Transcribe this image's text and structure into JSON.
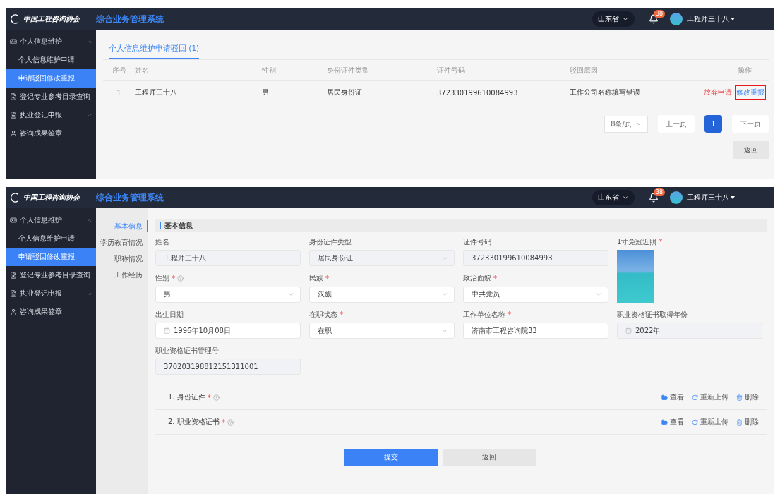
{
  "screens": [
    {
      "kind": "list",
      "header": {
        "logo_text": "中国工程咨询协会",
        "system_title": "综合业务管理系统",
        "region": "山东省",
        "notification_count": "38",
        "user_name": "工程师三十八"
      },
      "sidebar": [
        {
          "label": "个人信息维护",
          "expanded": true,
          "children": [
            {
              "label": "个人信息维护申请",
              "selected": false
            },
            {
              "label": "申请驳回修改重报",
              "selected": true
            }
          ]
        },
        {
          "label": "登记专业参考目录查询"
        },
        {
          "label": "执业登记申报",
          "expanded": false
        },
        {
          "label": "咨询成果签章"
        }
      ],
      "tabs": [
        {
          "label": "个人信息维护申请驳回 (1)",
          "selected": true
        }
      ],
      "table": {
        "columns": [
          "序号",
          "姓名",
          "性别",
          "身份证件类型",
          "证件号码",
          "驳回原因",
          "操作"
        ],
        "rows": [
          {
            "cells": [
              "1",
              "工程师三十八",
              "男",
              "居民身份证",
              "372330199610084993",
              "工作公司名称填写错误"
            ],
            "actions": [
              {
                "label": "放弃申请",
                "kind": "danger",
                "highlighted": false
              },
              {
                "label": "修改重报",
                "kind": "primary",
                "highlighted": true
              }
            ]
          }
        ]
      },
      "pagination": {
        "page_size": "8条/页",
        "prev": "上一页",
        "pages": [
          {
            "label": "1",
            "selected": true
          }
        ],
        "next": "下一页"
      },
      "back_button": "返回"
    },
    {
      "kind": "form",
      "header": {
        "logo_text": "中国工程咨询协会",
        "system_title": "综合业务管理系统",
        "region": "山东省",
        "notification_count": "38",
        "user_name": "工程师三十八"
      },
      "sidebar": [
        {
          "label": "个人信息维护",
          "expanded": true,
          "children": [
            {
              "label": "个人信息维护申请",
              "selected": false
            },
            {
              "label": "申请驳回修改重报",
              "selected": true
            }
          ]
        },
        {
          "label": "登记专业参考目录查询"
        },
        {
          "label": "执业登记申报",
          "expanded": false
        },
        {
          "label": "咨询成果签章"
        }
      ],
      "sub_nav": [
        {
          "label": "基本信息",
          "selected": true
        },
        {
          "label": "学历教育情况",
          "selected": false
        },
        {
          "label": "职称情况",
          "selected": false
        },
        {
          "label": "工作经历",
          "selected": false
        }
      ],
      "section_title": "基本信息",
      "fields": [
        {
          "label": "姓名",
          "kind": "text",
          "value": "工程师三十八",
          "disabled": true
        },
        {
          "label": "身份证件类型",
          "kind": "select",
          "value": "居民身份证",
          "disabled": true
        },
        {
          "label": "证件号码",
          "kind": "text",
          "value": "372330199610084993",
          "disabled": true
        },
        {
          "label": "1寸免冠近照",
          "kind": "photo",
          "required_mark": "*"
        },
        {
          "label": "性别",
          "kind": "select",
          "value": "男",
          "required_mark": "*",
          "help": true,
          "disabled": false
        },
        {
          "label": "民族",
          "kind": "select",
          "value": "汉族",
          "required_mark": "*",
          "disabled": false
        },
        {
          "label": "政治面貌",
          "kind": "select",
          "value": "中共党员",
          "required_mark": "*",
          "disabled": false
        },
        {
          "label": "出生日期",
          "kind": "date",
          "value": "1996年10月08日",
          "disabled": false
        },
        {
          "label": "在职状态",
          "kind": "select",
          "value": "在职",
          "required_mark": "*",
          "disabled": false
        },
        {
          "label": "工作单位名称",
          "kind": "text",
          "value": "济南市工程咨询院33",
          "required_mark": "*",
          "disabled": false
        },
        {
          "label": "职业资格证书取得年份",
          "kind": "date",
          "value": "2022年",
          "disabled": true
        },
        {
          "label": "职业资格证书管理号",
          "kind": "text",
          "value": "370203198812151311001",
          "disabled": true
        }
      ],
      "attachments": [
        {
          "label": "1. 身份证件",
          "required_mark": "*",
          "actions": [
            {
              "kind": "view",
              "label": "查看"
            },
            {
              "kind": "reupload",
              "label": "重新上传"
            },
            {
              "kind": "delete",
              "label": "删除"
            }
          ]
        },
        {
          "label": "2. 职业资格证书",
          "required_mark": "*",
          "actions": [
            {
              "kind": "view",
              "label": "查看"
            },
            {
              "kind": "reupload",
              "label": "重新上传"
            },
            {
              "kind": "delete",
              "label": "删除"
            }
          ]
        }
      ],
      "buttons": [
        {
          "label": "提交",
          "kind": "primary"
        },
        {
          "label": "返回",
          "kind": "secondary"
        }
      ]
    }
  ]
}
